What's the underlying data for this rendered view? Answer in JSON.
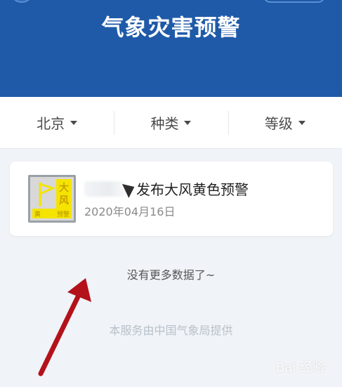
{
  "header": {
    "title": "气象灾害预警"
  },
  "filters": [
    {
      "label": "北京"
    },
    {
      "label": "种类"
    },
    {
      "label": "等级"
    }
  ],
  "card": {
    "headline": "发布大风黄色预警",
    "date": "2020年04月16日",
    "badge": {
      "big_text_1": "大",
      "big_text_2": "风",
      "bottom_left": "黄",
      "bottom_right": "预警"
    }
  },
  "status": {
    "no_more": "没有更多数据了~"
  },
  "footer": {
    "text": "本服务由中国气象局提供"
  },
  "watermark": {
    "text": "Bai 经验"
  },
  "colors": {
    "header_bg": "#1f5aa8",
    "badge_yellow": "#f4e400",
    "arrow_red": "#b3121b"
  }
}
